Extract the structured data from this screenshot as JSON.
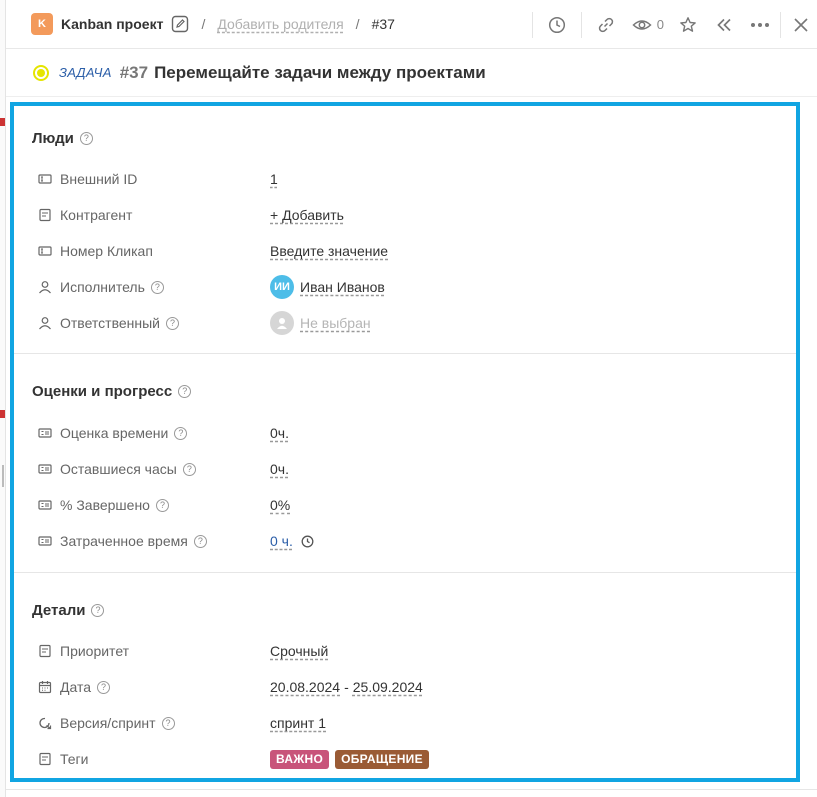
{
  "breadcrumb": {
    "project_badge": "K",
    "project_name": "Kanban проект",
    "separator": "/",
    "add_parent": "Добавить родителя",
    "task_ref": "#37"
  },
  "toolbar": {
    "watch_count": "0",
    "icons": [
      "clock-icon",
      "link-icon",
      "eye-icon",
      "star-icon",
      "collapse-icon",
      "more-icon",
      "close-icon"
    ]
  },
  "task": {
    "type": "ЗАДАЧА",
    "number": "#37",
    "title": "Перемещайте задачи между проектами",
    "status_color": "#e5e500"
  },
  "sections": {
    "people": {
      "title": "Люди",
      "rows": {
        "external_id": {
          "label": "Внешний ID",
          "value": "1"
        },
        "counterparty": {
          "label": "Контрагент",
          "value": "+ Добавить"
        },
        "clickup_number": {
          "label": "Номер Кликап",
          "value": "Введите значение"
        },
        "assignee": {
          "label": "Исполнитель",
          "initials": "ИИ",
          "value": "Иван Иванов"
        },
        "responsible": {
          "label": "Ответственный",
          "value": "Не выбран"
        }
      }
    },
    "estimates": {
      "title": "Оценки и прогресс",
      "rows": {
        "time_estimate": {
          "label": "Оценка времени",
          "value": "0ч."
        },
        "remaining": {
          "label": "Оставшиеся часы",
          "value": "0ч."
        },
        "percent_done": {
          "label": "% Завершено",
          "value": "0%"
        },
        "time_spent": {
          "label": "Затраченное время",
          "value": "0 ч."
        }
      }
    },
    "details": {
      "title": "Детали",
      "rows": {
        "priority": {
          "label": "Приоритет",
          "value": "Срочный"
        },
        "date": {
          "label": "Дата",
          "start": "20.08.2024",
          "dash": "-",
          "end": "25.09.2024"
        },
        "sprint": {
          "label": "Версия/спринт",
          "value": "спринт 1"
        },
        "tags": {
          "label": "Теги",
          "items": [
            {
              "text": "ВАЖНО",
              "color": "#c8547a"
            },
            {
              "text": "ОБРАЩЕНИЕ",
              "color": "#9a5b35"
            }
          ]
        }
      }
    }
  },
  "colors": {
    "accent_border": "#11a5e2",
    "link_blue": "#2b5ea8"
  }
}
